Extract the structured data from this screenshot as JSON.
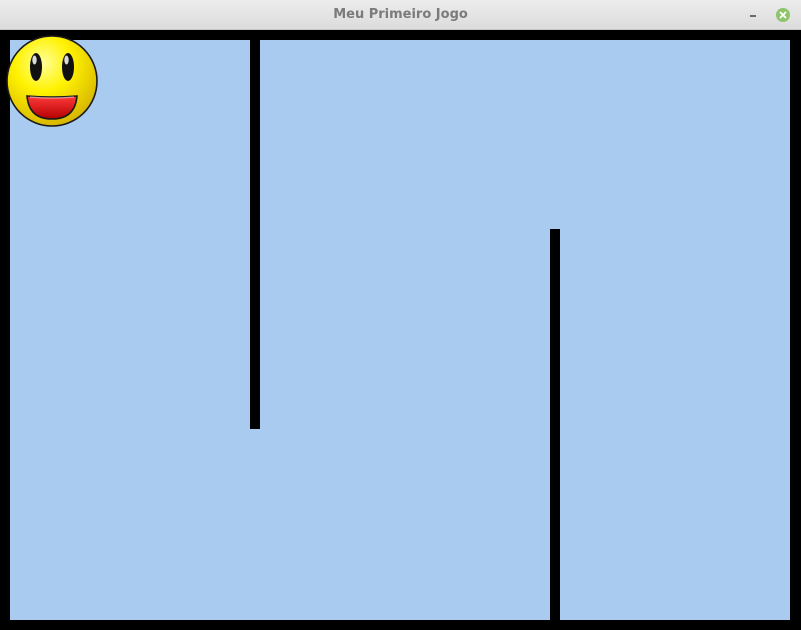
{
  "window": {
    "title": "Meu Primeiro Jogo",
    "controls": {
      "minimize_icon": "minimize-icon",
      "close_icon": "close-icon"
    }
  },
  "game": {
    "background_color": "#a8cbef",
    "border_color": "#000000",
    "player": {
      "icon": "smiley-face-icon",
      "face_color": "#f5e600",
      "mouth_color": "#e30000"
    },
    "walls": [
      {
        "name": "upper-wall"
      },
      {
        "name": "lower-wall"
      }
    ]
  }
}
